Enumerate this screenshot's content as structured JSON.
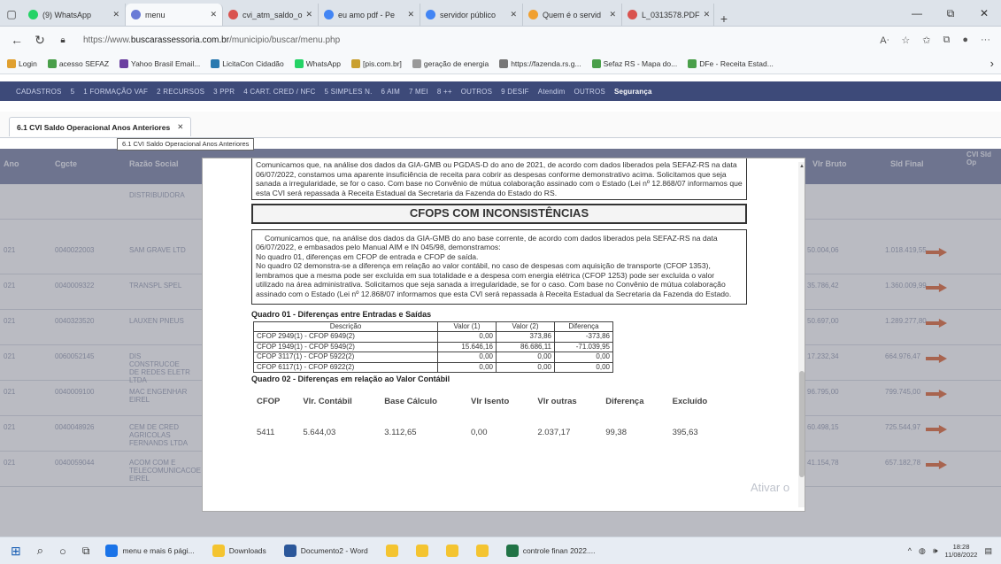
{
  "browser": {
    "tabs": [
      {
        "label": "(9) WhatsApp",
        "color": "#25d366"
      },
      {
        "label": "menu",
        "color": "#6a7bd6"
      },
      {
        "label": "cvi_atm_saldo_o",
        "color": "#d9534f"
      },
      {
        "label": "eu amo pdf - Pe",
        "color": "#4285f4"
      },
      {
        "label": "servidor público",
        "color": "#4285f4"
      },
      {
        "label": "Quem é o servid",
        "color": "#f0a030"
      },
      {
        "label": "L_0313578.PDF",
        "color": "#d9534f"
      }
    ],
    "url_prefix": "https://www.",
    "url_domain": "buscarassessoria.com.br",
    "url_path": "/municipio/buscar/menu.php",
    "bookmarks": [
      {
        "label": "Login",
        "color": "#e0a030"
      },
      {
        "label": "acesso SEFAZ",
        "color": "#4a9f4a"
      },
      {
        "label": "Yahoo Brasil Email...",
        "color": "#6b3fa0"
      },
      {
        "label": "LicitaCon Cidadão",
        "color": "#2a7ab0"
      },
      {
        "label": "WhatsApp",
        "color": "#25d366"
      },
      {
        "label": "[pis.com.br]",
        "color": "#c9a030"
      },
      {
        "label": "geração de energia",
        "color": "#999999"
      },
      {
        "label": "https://fazenda.rs.g...",
        "color": "#777777"
      },
      {
        "label": "Sefaz RS - Mapa do...",
        "color": "#4a9f4a"
      },
      {
        "label": "DFe - Receita Estad...",
        "color": "#4a9f4a"
      }
    ]
  },
  "menu": [
    "CADASTROS",
    "5",
    "1 FORMAÇÃO VAF",
    "2 RECURSOS",
    "3 PPR",
    "4 CART. CRED / NFC",
    "5 SIMPLES N.",
    "6 AIM",
    "7 MEI",
    "8 ++",
    "OUTROS",
    "9 DESIF",
    "Atendim",
    "OUTROS",
    "Segurança"
  ],
  "page_tab": {
    "label": "6.1 CVI Saldo Operacional Anos Anteriores",
    "tooltip": "6.1 CVI Saldo Operacional Anos Anteriores"
  },
  "grid": {
    "headers": [
      "Ano",
      "Cgcte",
      "Razão Social",
      "Vlr Bruto",
      "Sld Final",
      "CVI Sld Op"
    ],
    "rows": [
      {
        "ano": "",
        "cgcte": "",
        "razao": "DISTRIBUIDORA",
        "bruto": "",
        "final": ""
      },
      {
        "ano": "021",
        "cgcte": "0040022003",
        "razao": "SAM GRAVE LTD",
        "bruto": "50.004,06",
        "final": "1.018.419,55"
      },
      {
        "ano": "021",
        "cgcte": "0040009322",
        "razao": "TRANSPL SPEL",
        "bruto": "35.786,42",
        "final": "1.360.009,99"
      },
      {
        "ano": "021",
        "cgcte": "0040323520",
        "razao": "LAUXEN PNEUS",
        "bruto": "50.697,00",
        "final": "1.289.277,80"
      },
      {
        "ano": "021",
        "cgcte": "0060052145",
        "razao": "DIS CONSTRUCOE DE REDES ELETR LTDA",
        "bruto": "17.232,34",
        "final": "664.976,47"
      },
      {
        "ano": "021",
        "cgcte": "0040009100",
        "razao": "MAC ENGENHAR EIREL",
        "bruto": "96.795,00",
        "final": "799.745,00"
      },
      {
        "ano": "021",
        "cgcte": "0040048926",
        "razao": "CEM DE CRED AGRICOLAS FERNANDS LTDA",
        "bruto": "60.498,15",
        "final": "725.544,97"
      },
      {
        "ano": "021",
        "cgcte": "0040059044",
        "razao": "ACOM COM E TELECOMUNICACOE EIREL",
        "bruto": "41.154,78",
        "final": "657.182,78"
      }
    ]
  },
  "modal": {
    "intro": "Comunicamos que, na análise dos dados da GIA-GMB ou PGDAS-D do ano de 2021, de acordo com dados liberados pela SEFAZ-RS na data 06/07/2022, constamos uma aparente insuficiência de receita para cobrir as despesas conforme demonstrativo acima. Solicitamos que seja sanada a irregularidade, se for o caso. Com base no Convênio de mútua colaboração assinado com o Estado (Lei nº 12.868/07 informamos que esta CVI será repassada à Receita Estadual da Secretaria da Fazenda do Estado do RS.",
    "section_title": "CFOPS COM INCONSISTÊNCIAS",
    "para1": "Comunicamos que, na análise dos dados da GIA-GMB do ano base corrente, de acordo com dados liberados pela SEFAZ-RS na data 06/07/2022, e embasados pelo Manual AIM e IN 045/98, demonstramos:",
    "para2": "No quadro 01, diferenças em CFOP de entrada e CFOP de saída.",
    "para3": "No quadro 02 demonstra-se a diferença em relação ao valor contábil, no caso de despesas com aquisição de transporte (CFOP 1353), lembramos que a mesma pode ser excluída em sua totalidade e a despesa com energia elétrica (CFOP 1253) pode ser excluída o valor utilizado na área administrativa. Solicitamos que seja sanada a irregularidade, se for o caso. Com base no Convênio de mútua colaboração assinado com o Estado (Lei nº 12.868/07 informamos que esta CVI será repassada à Receita Estadual da Secretaria da Fazenda do Estado.",
    "q1_title": "Quadro 01 - Diferenças entre Entradas e Saídas",
    "q1_headers": [
      "Descrição",
      "Valor (1)",
      "Valor (2)",
      "Diferença"
    ],
    "q1_rows": [
      [
        "CFOP 2949(1) - CFOP 6949(2)",
        "0,00",
        "373,86",
        "-373,86"
      ],
      [
        "CFOP 1949(1) - CFOP 5949(2)",
        "15.646,16",
        "86.686,11",
        "-71.039,95"
      ],
      [
        "CFOP 3117(1) - CFOP 5922(2)",
        "0,00",
        "0,00",
        "0,00"
      ],
      [
        "CFOP 6117(1) - CFOP 6922(2)",
        "0,00",
        "0,00",
        "0,00"
      ]
    ],
    "q2_title": "Quadro 02 - Diferenças em relação ao Valor Contábil",
    "q2_headers": [
      "CFOP",
      "Vlr. Contábil",
      "Base Cálculo",
      "Vlr Isento",
      "Vlr outras",
      "Diferença",
      "Excluído"
    ],
    "q2_row": [
      "5411",
      "5.644,03",
      "3.112,65",
      "0,00",
      "2.037,17",
      "99,38",
      "395,63"
    ]
  },
  "watermark": "Ativar o",
  "taskbar": {
    "items": [
      {
        "label": "menu e mais 6 pági...",
        "color": "#1a73e8"
      },
      {
        "label": "Downloads",
        "color": "#f4c430"
      },
      {
        "label": "Documento2 - Word",
        "color": "#2b579a"
      },
      {
        "label": "",
        "color": "#f4c430"
      },
      {
        "label": "",
        "color": "#f4c430"
      },
      {
        "label": "",
        "color": "#f4c430"
      },
      {
        "label": "",
        "color": "#f4c430"
      },
      {
        "label": "controle finan 2022....",
        "color": "#217346"
      }
    ],
    "time": "18:28",
    "date": "11/08/2022"
  }
}
